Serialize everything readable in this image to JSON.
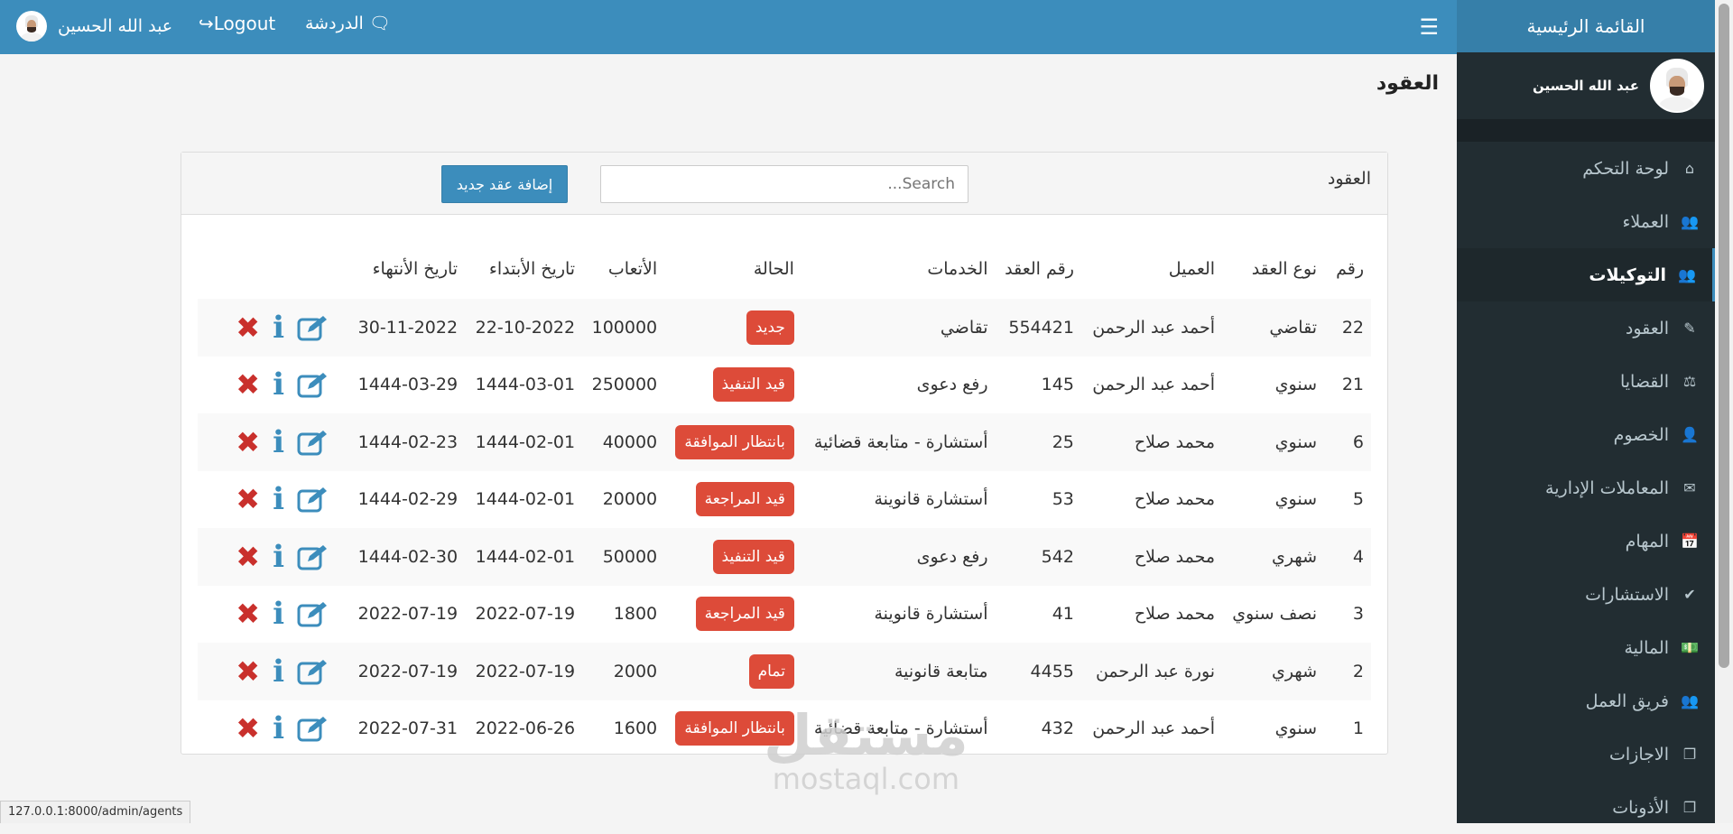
{
  "topbar": {
    "user_name": "عبد الله الحسين",
    "logout_label": "Logout",
    "chat_label": "الدردشة"
  },
  "sidebar": {
    "header": "القائمة الرئيسية",
    "user_name": "عبد الله الحسين",
    "items": [
      {
        "label": "لوحة التحكم",
        "icon": "home-icon"
      },
      {
        "label": "العملاء",
        "icon": "users-icon"
      },
      {
        "label": "التوكيلات",
        "icon": "users-icon",
        "active": true
      },
      {
        "label": "العقود",
        "icon": "edit-icon"
      },
      {
        "label": "القضايا",
        "icon": "balance-icon"
      },
      {
        "label": "الخصوم",
        "icon": "user-x-icon"
      },
      {
        "label": "المعاملات الإدارية",
        "icon": "envelope-icon"
      },
      {
        "label": "المهام",
        "icon": "calendar-icon"
      },
      {
        "label": "الاستشارات",
        "icon": "check-icon"
      },
      {
        "label": "المالية",
        "icon": "money-icon"
      },
      {
        "label": "فريق العمل",
        "icon": "users-icon"
      },
      {
        "label": "الاجازات",
        "icon": "copy-icon"
      },
      {
        "label": "الأذونات",
        "icon": "copy-icon"
      }
    ]
  },
  "page": {
    "title": "العقود"
  },
  "panel": {
    "title": "العقود",
    "search_placeholder": "Search...",
    "add_button": "إضافة عقد جديد"
  },
  "table": {
    "headers": [
      "رقم",
      "نوع العقد",
      "العميل",
      "رقم العقد",
      "الخدمات",
      "الحالة",
      "الأتعاب",
      "تاريخ الأبتداء",
      "تاريخ الأنتهاء"
    ],
    "rows": [
      {
        "id": "22",
        "type": "تقاضي",
        "client": "أحمد عبد الرحمن",
        "contract_no": "554421",
        "services": "تقاضي",
        "status": "جديد",
        "fees": "100000",
        "start": "22-10-2022",
        "end": "30-11-2022"
      },
      {
        "id": "21",
        "type": "سنوي",
        "client": "أحمد عبد الرحمن",
        "contract_no": "145",
        "services": "رفع دعوى",
        "status": "قيد التنفيذ",
        "fees": "250000",
        "start": "1444-03-01",
        "end": "1444-03-29"
      },
      {
        "id": "6",
        "type": "سنوي",
        "client": "محمد صلاح",
        "contract_no": "25",
        "services": "أستشارة - متابعة قضائية",
        "status": "بانتظار الموافقة",
        "fees": "40000",
        "start": "1444-02-01",
        "end": "1444-02-23"
      },
      {
        "id": "5",
        "type": "سنوي",
        "client": "محمد صلاح",
        "contract_no": "53",
        "services": "أستشارة قانوينة",
        "status": "قيد المراجعة",
        "fees": "20000",
        "start": "1444-02-01",
        "end": "1444-02-29"
      },
      {
        "id": "4",
        "type": "شهري",
        "client": "محمد صلاح",
        "contract_no": "542",
        "services": "رفع دعوى",
        "status": "قيد التنفيذ",
        "fees": "50000",
        "start": "1444-02-01",
        "end": "1444-02-30"
      },
      {
        "id": "3",
        "type": "نصف سنوي",
        "client": "محمد صلاح",
        "contract_no": "41",
        "services": "أستشارة قانوينة",
        "status": "قيد المراجعة",
        "fees": "1800",
        "start": "2022-07-19",
        "end": "2022-07-19"
      },
      {
        "id": "2",
        "type": "شهري",
        "client": "نورة عبد الرحمن",
        "contract_no": "4455",
        "services": "متابعة قانونية",
        "status": "تمام",
        "fees": "2000",
        "start": "2022-07-19",
        "end": "2022-07-19"
      },
      {
        "id": "1",
        "type": "سنوي",
        "client": "أحمد عبد الرحمن",
        "contract_no": "432",
        "services": "أستشارة - متابعة قضائية",
        "status": "بانتظار الموافقة",
        "fees": "1600",
        "start": "2022-06-26",
        "end": "2022-07-31"
      }
    ]
  },
  "watermark": {
    "arabic": "مستقل",
    "latin": "mostaql.com"
  },
  "status_url": "127.0.0.1:8000/admin/agents",
  "colors": {
    "primary": "#3c8dbc",
    "sidebar": "#222d32",
    "danger": "#dd4b39"
  }
}
